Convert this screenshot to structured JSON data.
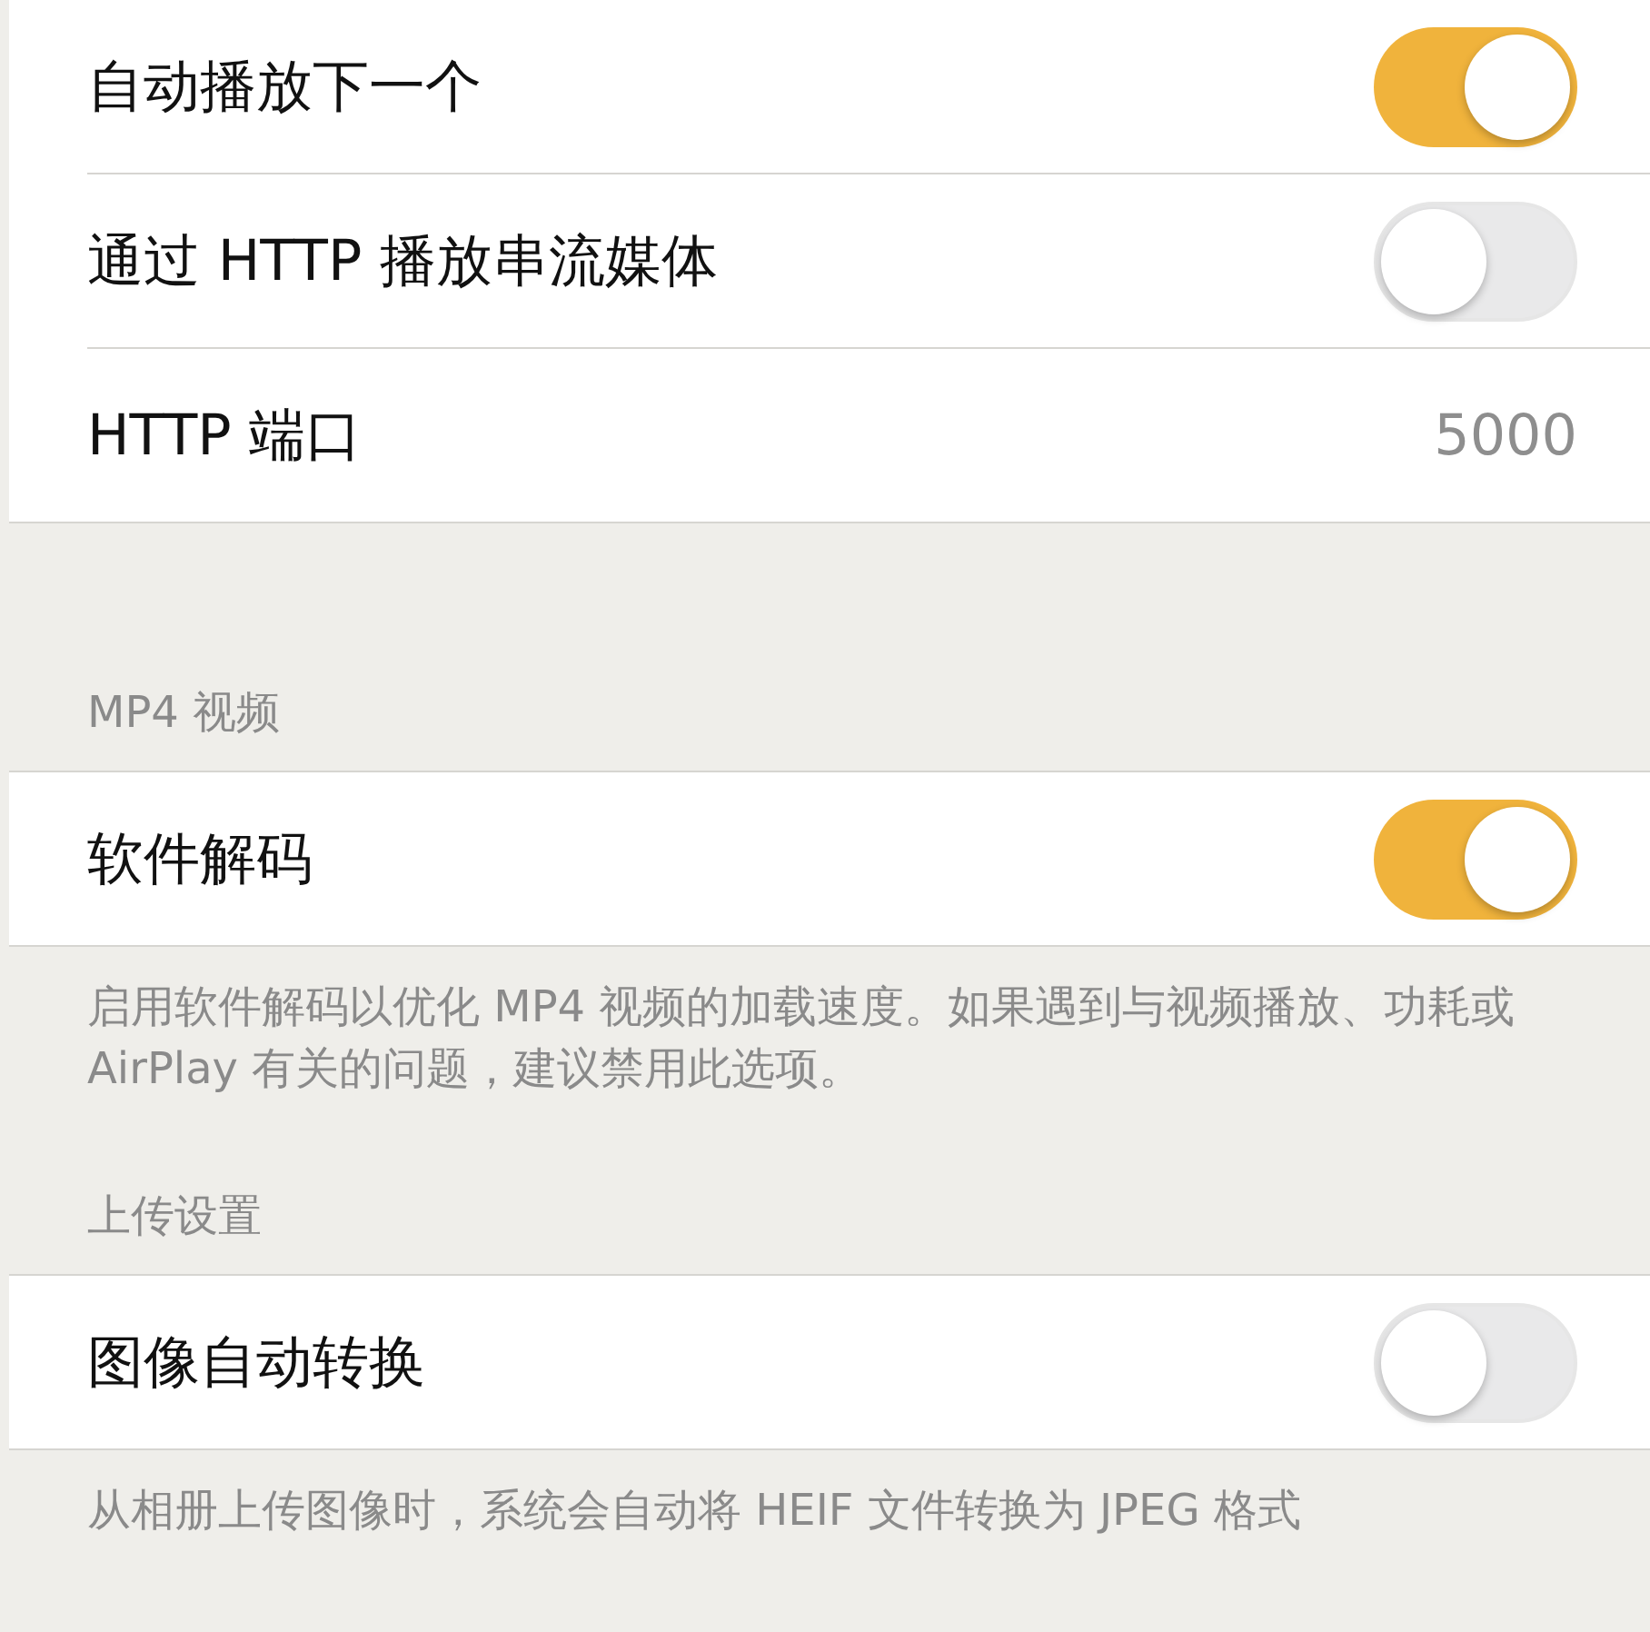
{
  "sections": [
    {
      "rows": [
        {
          "kind": "toggle",
          "label": "自动播放下一个",
          "on": true
        },
        {
          "kind": "toggle",
          "label": "通过 HTTP 播放串流媒体",
          "on": false
        },
        {
          "kind": "value",
          "label": "HTTP 端口",
          "value": "5000"
        }
      ]
    },
    {
      "header": "MP4 视频",
      "rows": [
        {
          "kind": "toggle",
          "label": "软件解码",
          "on": true
        }
      ],
      "footer": "启用软件解码以优化 MP4 视频的加载速度。如果遇到与视频播放、功耗或 AirPlay 有关的问题，建议禁用此选项。"
    },
    {
      "header": "上传设置",
      "rows": [
        {
          "kind": "toggle",
          "label": "图像自动转换",
          "on": false
        }
      ],
      "footer": "从相册上传图像时，系统会自动将 HEIF 文件转换为 JPEG 格式"
    }
  ]
}
